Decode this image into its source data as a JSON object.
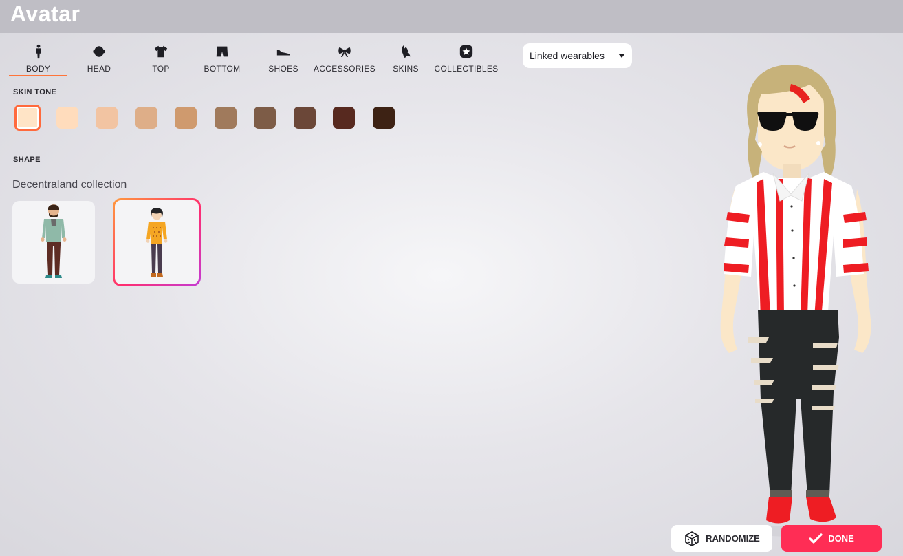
{
  "header": {
    "title": "Avatar"
  },
  "tabs": [
    {
      "label": "BODY",
      "icon": "body-icon",
      "active": true
    },
    {
      "label": "HEAD",
      "icon": "head-icon"
    },
    {
      "label": "TOP",
      "icon": "shirt-icon"
    },
    {
      "label": "BOTTOM",
      "icon": "shorts-icon"
    },
    {
      "label": "SHOES",
      "icon": "shoe-icon"
    },
    {
      "label": "ACCESSORIES",
      "icon": "bow-icon"
    },
    {
      "label": "SKINS",
      "icon": "skin-icon"
    },
    {
      "label": "COLLECTIBLES",
      "icon": "star-badge-icon"
    }
  ],
  "filter": {
    "selected": "Linked wearables"
  },
  "skin_tone": {
    "label": "SKIN TONE",
    "selected_index": 0,
    "colors": [
      "#ffe4c6",
      "#ffdcbc",
      "#f2c4a2",
      "#deae88",
      "#cf9a6e",
      "#a07a5c",
      "#7d5c47",
      "#6b4738",
      "#57291f",
      "#3d2214"
    ]
  },
  "shape": {
    "label": "SHAPE",
    "collection_title": "Decentraland collection",
    "options": [
      {
        "name": "male-body-shape",
        "selected": false
      },
      {
        "name": "female-body-shape",
        "selected": true
      }
    ]
  },
  "actions": {
    "randomize_label": "RANDOMIZE",
    "done_label": "DONE"
  },
  "colors": {
    "accent": "#ff7439",
    "done": "#ff2d55",
    "topbar": "#bfbec5"
  }
}
